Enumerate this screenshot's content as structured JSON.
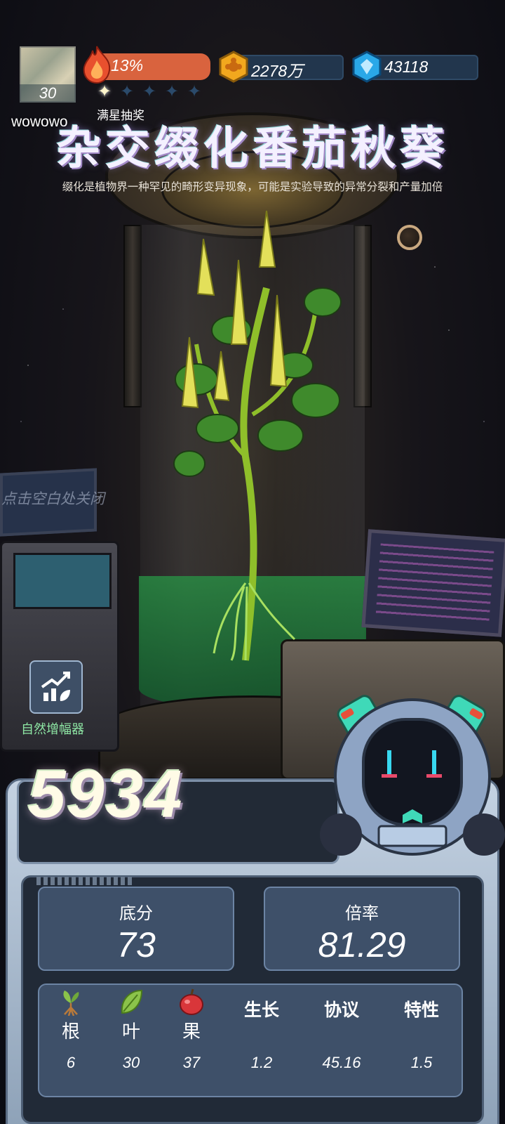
{
  "player": {
    "level": "30",
    "name": "wowowo",
    "fire_percent": "13%",
    "stars_total": 5,
    "stars_lit": 1,
    "full_star_label": "满星抽奖"
  },
  "resources": {
    "coin": {
      "value": "2278万",
      "icon": "gold-flower-coin-icon"
    },
    "gem": {
      "value": "43118",
      "icon": "blue-diamond-icon"
    }
  },
  "plant": {
    "title": "杂交缀化番茄秋葵",
    "description": "缀化是植物界一种罕见的畸形变异现象，可能是实验导致的异常分裂和产量加倍"
  },
  "hints": {
    "close": "点击空白处关闭"
  },
  "amplifier": {
    "label": "自然增幅器",
    "icon": "growth-chart-icon"
  },
  "score": {
    "total": "5934",
    "base_label": "底分",
    "base_value": "73",
    "rate_label": "倍率",
    "rate_value": "81.29"
  },
  "factors": [
    {
      "name": "根",
      "value": "6",
      "icon": "sprout-root-icon"
    },
    {
      "name": "叶",
      "value": "30",
      "icon": "leaf-icon"
    },
    {
      "name": "果",
      "value": "37",
      "icon": "apple-icon"
    },
    {
      "name": "生长",
      "value": "1.2"
    },
    {
      "name": "协议",
      "value": "45.16"
    },
    {
      "name": "特性",
      "value": "1.5"
    }
  ],
  "colors": {
    "fire": "#d9633e",
    "panel": "#3e5069",
    "accent_green": "#8ee6a4"
  }
}
